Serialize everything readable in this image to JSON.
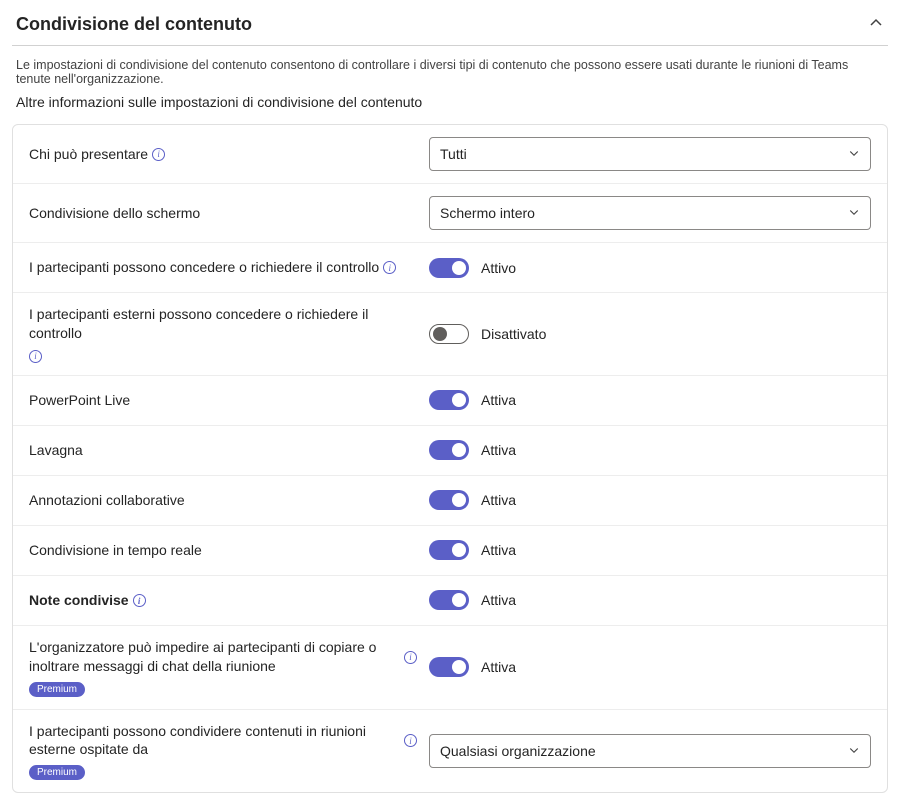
{
  "header": {
    "title": "Condivisione del contenuto"
  },
  "description": "Le impostazioni di condivisione del contenuto consentono di controllare i diversi tipi di contenuto che possono essere usati durante le riunioni di Teams tenute nell'organizzazione.",
  "more_info_link": "Altre informazioni sulle impostazioni di condivisione del contenuto",
  "status": {
    "on": "Attivo",
    "off": "Disattivato",
    "on_f": "Attiva"
  },
  "badge": {
    "premium": "Premium"
  },
  "rows": {
    "who_can_present": {
      "label": "Chi può presentare",
      "value": "Tutti"
    },
    "screen_sharing": {
      "label": "Condivisione dello schermo",
      "value": "Schermo intero"
    },
    "give_request_control": {
      "label": "I partecipanti possono concedere o richiedere il controllo"
    },
    "external_give_request_control": {
      "label": "I partecipanti esterni possono concedere o richiedere il controllo"
    },
    "powerpoint_live": {
      "label": "PowerPoint Live"
    },
    "whiteboard": {
      "label": "Lavagna"
    },
    "collab_annotations": {
      "label": "Annotazioni collaborative"
    },
    "live_share": {
      "label": "Condivisione in tempo reale"
    },
    "shared_notes": {
      "label": "Note condivise"
    },
    "restrict_copy_forward": {
      "label": "L'organizzatore può impedire ai partecipanti di copiare o inoltrare messaggi di chat della riunione"
    },
    "share_external_meetings": {
      "label": "I partecipanti possono condividere contenuti in riunioni esterne ospitate da",
      "value": "Qualsiasi organizzazione"
    }
  }
}
